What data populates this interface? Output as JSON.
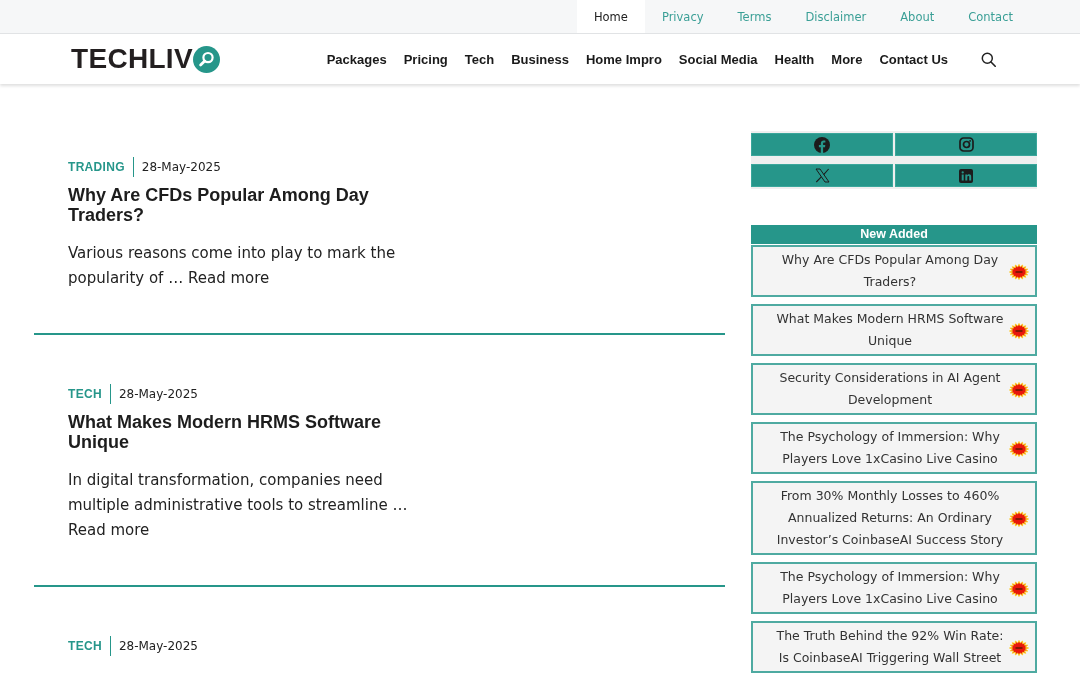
{
  "top_menu": [
    {
      "label": "Home",
      "selected": true
    },
    {
      "label": "Privacy",
      "selected": false
    },
    {
      "label": "Terms",
      "selected": false
    },
    {
      "label": "Disclaimer",
      "selected": false
    },
    {
      "label": "About",
      "selected": false
    },
    {
      "label": "Contact",
      "selected": false
    }
  ],
  "header": {
    "logo": "TECHLIV",
    "nav": [
      "Packages",
      "Pricing",
      "Tech",
      "Business",
      "Home Impro",
      "Social Media",
      "Health",
      "More",
      "Contact Us"
    ]
  },
  "articles": [
    {
      "category": "TRADING",
      "date": "28-May-2025",
      "title": "Why Are CFDs Popular Among Day Traders?",
      "excerpt": "Various reasons come into play to mark the popularity of …",
      "read_more": "Read more"
    },
    {
      "category": "TECH",
      "date": "28-May-2025",
      "title": "What Makes Modern HRMS Software Unique",
      "excerpt": "In digital transformation, companies need multiple administrative tools to streamline …",
      "read_more": "Read more"
    },
    {
      "category": "TECH",
      "date": "28-May-2025"
    }
  ],
  "sidebar": {
    "social": [
      {
        "kind": "facebook"
      },
      {
        "kind": "instagram"
      },
      {
        "kind": "x"
      },
      {
        "kind": "linkedin"
      }
    ],
    "new_added": {
      "title": "New Added",
      "items": [
        {
          "title": "Why Are CFDs Popular Among Day Traders?",
          "new_badge": true
        },
        {
          "title": "What Makes Modern HRMS Software Unique",
          "new_badge": true
        },
        {
          "title": "Security Considerations in AI Agent Development",
          "new_badge": true
        },
        {
          "title": "The Psychology of Immersion: Why Players Love 1xCasino Live Casino",
          "new_badge": true
        },
        {
          "title": "From 30% Monthly Losses to 460% Annualized Returns: An Ordinary Investor’s CoinbaseAI Success Story",
          "new_badge": true
        },
        {
          "title": "The Psychology of Immersion: Why Players Love 1xCasino Live Casino",
          "new_badge": true
        },
        {
          "title": "The Truth Behind the 92% Win Rate: Is CoinbaseAI Triggering Wall Street",
          "new_badge": true
        }
      ]
    }
  }
}
